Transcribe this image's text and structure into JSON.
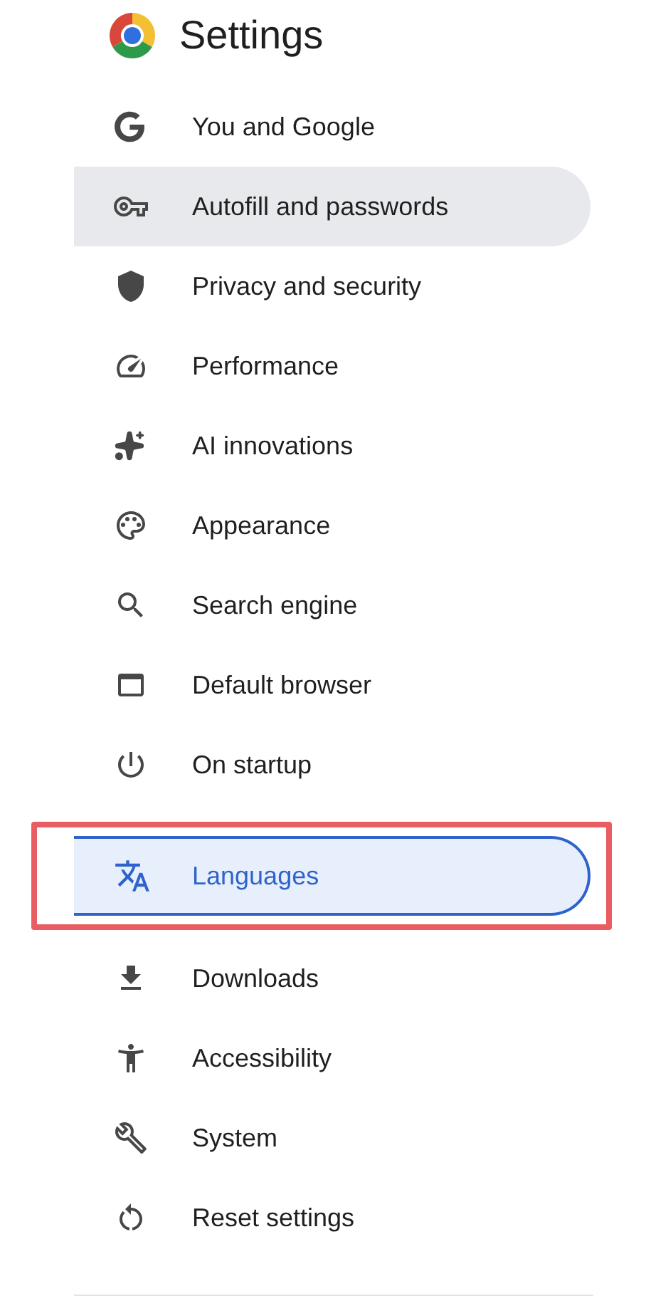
{
  "header": {
    "title": "Settings"
  },
  "menu": [
    {
      "label": "You and Google",
      "selected": false,
      "hovered": false,
      "annotated": false
    },
    {
      "label": "Autofill and passwords",
      "selected": false,
      "hovered": true,
      "annotated": false
    },
    {
      "label": "Privacy and security",
      "selected": false,
      "hovered": false,
      "annotated": false
    },
    {
      "label": "Performance",
      "selected": false,
      "hovered": false,
      "annotated": false
    },
    {
      "label": "AI innovations",
      "selected": false,
      "hovered": false,
      "annotated": false
    },
    {
      "label": "Appearance",
      "selected": false,
      "hovered": false,
      "annotated": false
    },
    {
      "label": "Search engine",
      "selected": false,
      "hovered": false,
      "annotated": false
    },
    {
      "label": "Default browser",
      "selected": false,
      "hovered": false,
      "annotated": false
    },
    {
      "label": "On startup",
      "selected": false,
      "hovered": false,
      "annotated": false
    },
    {
      "label": "Languages",
      "selected": true,
      "hovered": false,
      "annotated": true
    },
    {
      "label": "Downloads",
      "selected": false,
      "hovered": false,
      "annotated": false
    },
    {
      "label": "Accessibility",
      "selected": false,
      "hovered": false,
      "annotated": false
    },
    {
      "label": "System",
      "selected": false,
      "hovered": false,
      "annotated": false
    },
    {
      "label": "Reset settings",
      "selected": false,
      "hovered": false,
      "annotated": false
    }
  ]
}
